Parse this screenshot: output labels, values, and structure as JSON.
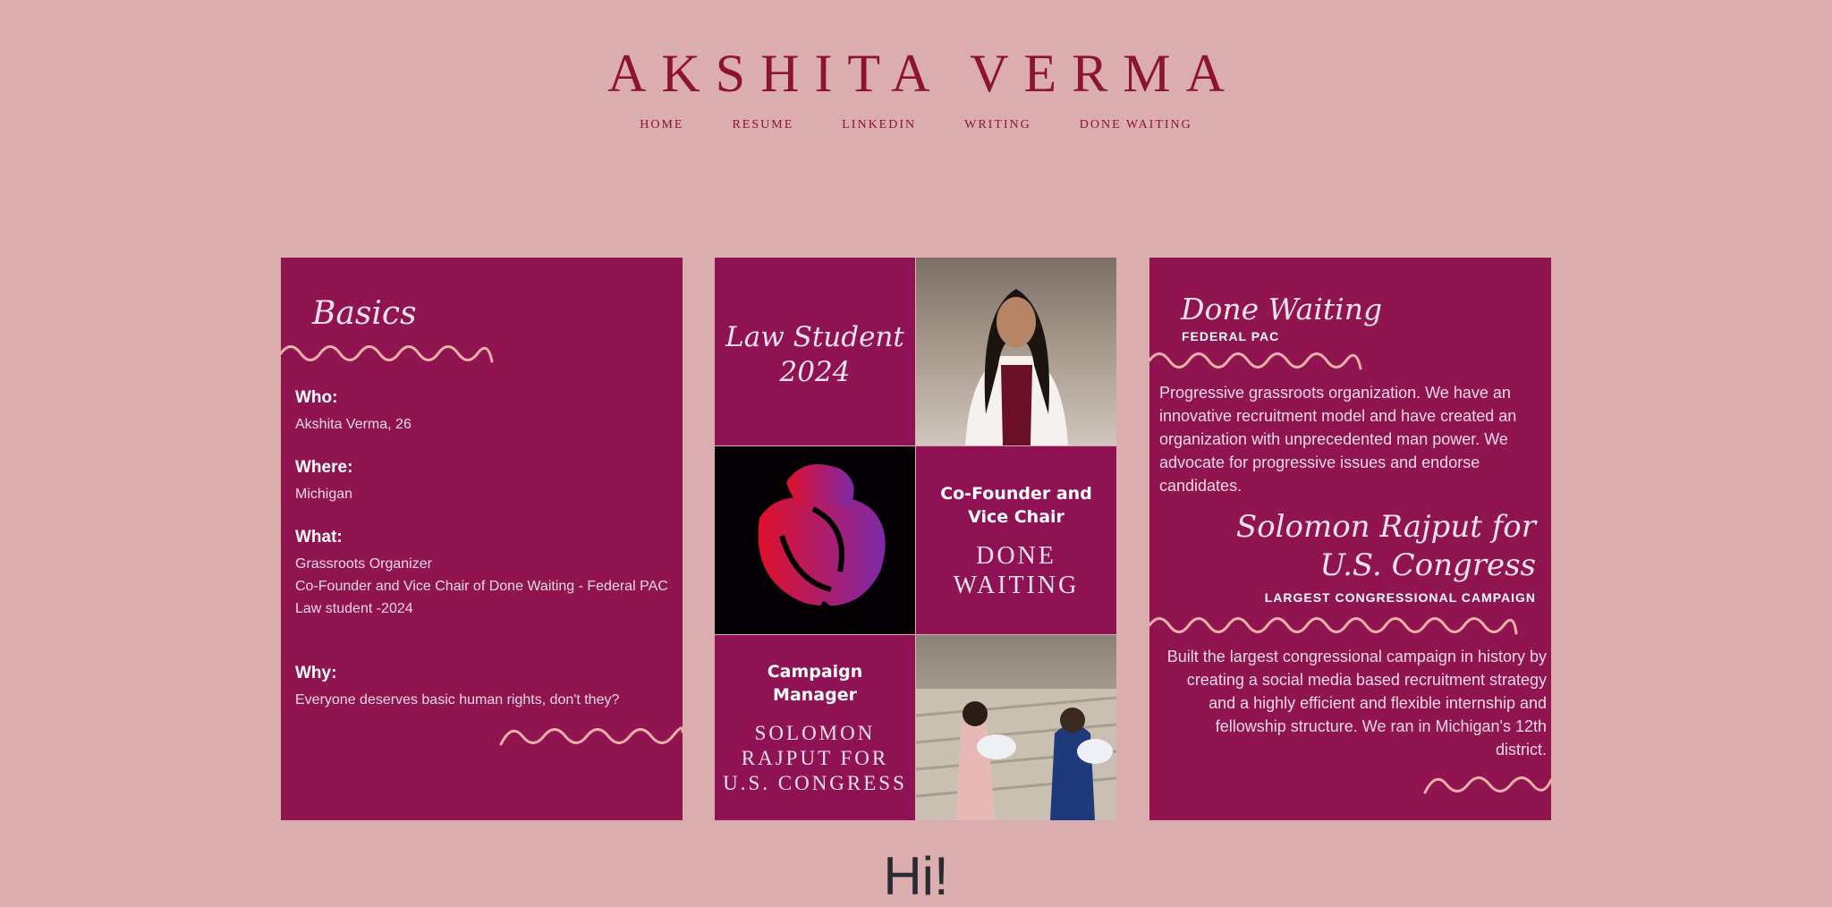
{
  "header": {
    "title": "AKSHITA VERMA",
    "nav": [
      "HOME",
      "RESUME",
      "LINKEDIN",
      "WRITING",
      "DONE WAITING"
    ]
  },
  "basics": {
    "title": "Basics",
    "items": [
      {
        "q": "Who:",
        "a": [
          "Akshita Verma, 26"
        ]
      },
      {
        "q": "Where:",
        "a": [
          "Michigan"
        ]
      },
      {
        "q": "What:",
        "a": [
          "Grassroots Organizer",
          "Co-Founder and Vice Chair of Done Waiting - Federal PAC",
          "Law student -2024"
        ]
      },
      {
        "q": "Why:",
        "a": [
          "Everyone deserves basic human rights, don't they?"
        ]
      }
    ]
  },
  "collage": {
    "law_student": [
      "Law Student",
      "2024"
    ],
    "cofounder": [
      "Co-Founder and",
      "Vice Chair"
    ],
    "done_waiting": [
      "DONE",
      "WAITING"
    ],
    "campaign_manager": [
      "Campaign",
      "Manager"
    ],
    "solomon": [
      "SOLOMON",
      "RAJPUT FOR",
      "U.S. CONGRESS"
    ]
  },
  "right": {
    "done_waiting_title": "Done Waiting",
    "done_waiting_sub": "FEDERAL PAC",
    "done_waiting_text": "Progressive grassroots organization. We have an innovative recruitment model and have created an organization with unprecedented man power. We advocate for progressive issues and endorse candidates.",
    "solomon_title": [
      "Solomon Rajput for",
      "U.S. Congress"
    ],
    "solomon_sub": "LARGEST CONGRESSIONAL CAMPAIGN",
    "solomon_text": "Built the largest congressional campaign in history by creating a social media based recruitment strategy and a highly efficient and flexible internship and fellowship structure. We ran in Michigan's 12th district."
  },
  "footer": {
    "greeting": "Hi!"
  },
  "colors": {
    "background": "#dcadae",
    "panel": "#901450",
    "accent": "#8c1432",
    "wave": "#efb0a5"
  }
}
